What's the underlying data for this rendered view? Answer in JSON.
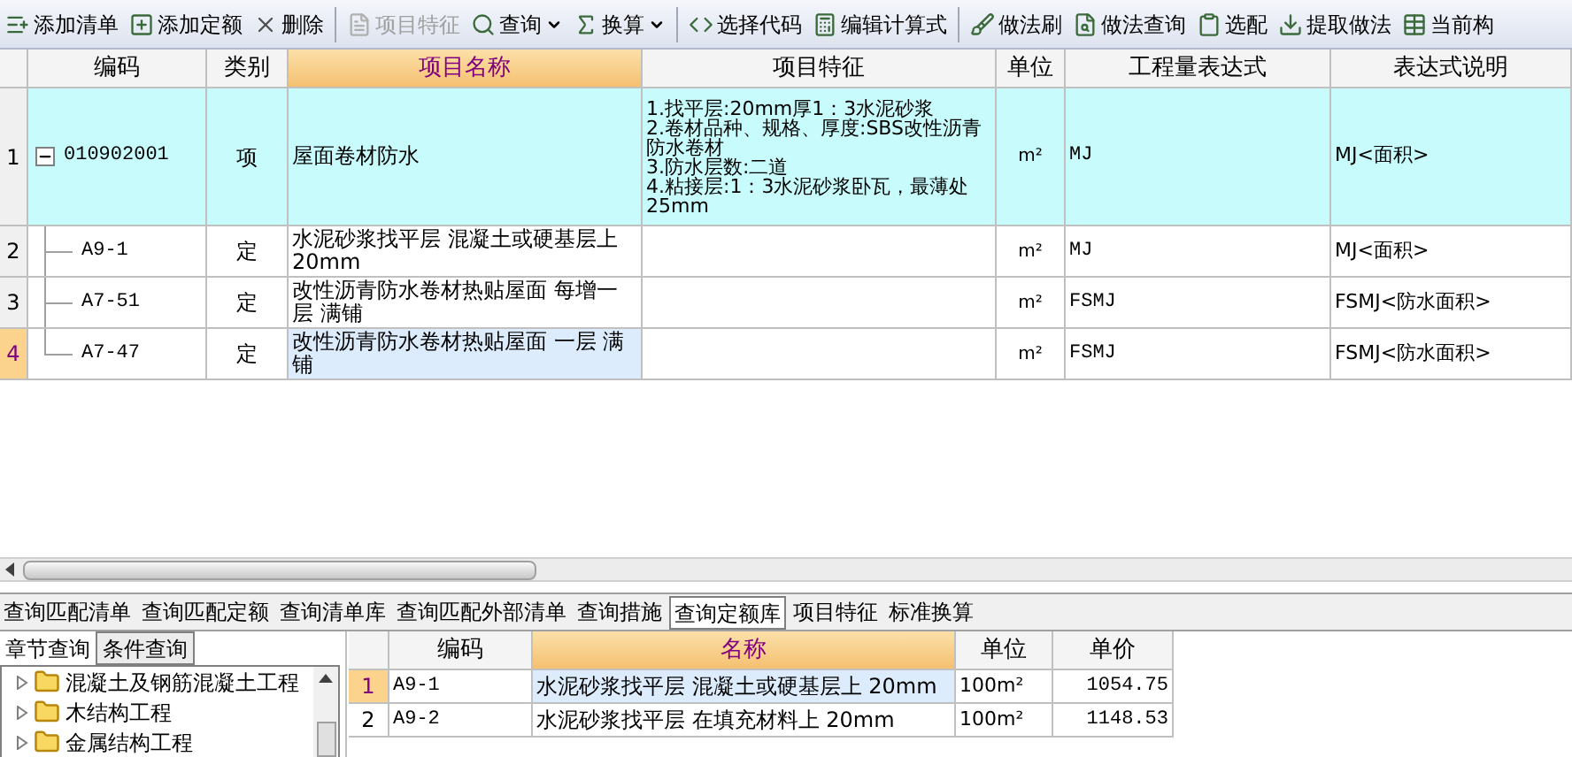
{
  "toolbar": [
    {
      "label": "添加清单",
      "disabled": false,
      "dropdown": false
    },
    {
      "label": "添加定额",
      "disabled": false,
      "dropdown": false
    },
    {
      "label": "删除",
      "disabled": false,
      "dropdown": false
    },
    {
      "label": "项目特征",
      "disabled": true,
      "dropdown": false
    },
    {
      "label": "查询",
      "disabled": false,
      "dropdown": true
    },
    {
      "label": "换算",
      "disabled": false,
      "dropdown": true
    },
    {
      "label": "选择代码",
      "disabled": false,
      "dropdown": false
    },
    {
      "label": "编辑计算式",
      "disabled": false,
      "dropdown": false
    },
    {
      "label": "做法刷",
      "disabled": false,
      "dropdown": false
    },
    {
      "label": "做法查询",
      "disabled": false,
      "dropdown": false
    },
    {
      "label": "选配",
      "disabled": false,
      "dropdown": false
    },
    {
      "label": "提取做法",
      "disabled": false,
      "dropdown": false
    },
    {
      "label": "当前构",
      "disabled": false,
      "dropdown": false
    }
  ],
  "table": {
    "columns": [
      "编码",
      "类别",
      "项目名称",
      "项目特征",
      "单位",
      "工程量表达式",
      "表达式说明"
    ],
    "rows": [
      {
        "number": "1",
        "code": "010902001",
        "category": "项",
        "name": "屋面卷材防水",
        "feature": "1.找平层:20mm厚1：3水泥砂浆\n2.卷材品种、规格、厚度:SBS改性沥青防水卷材\n3.防水层数:二道\n4.粘接层:1：3水泥砂浆卧瓦，最薄处25mm",
        "unit": "m²",
        "expression": "MJ",
        "expression_desc": "MJ<面积>",
        "selected": false,
        "expanded": true,
        "children": [
          {
            "number": "2",
            "code": "A9-1",
            "category": "定",
            "name": "水泥砂浆找平层 混凝土或硬基层上 20mm",
            "unit": "m²",
            "expression": "MJ",
            "expression_desc": "MJ<面积>",
            "selected": false
          },
          {
            "number": "3",
            "code": "A7-51",
            "category": "定",
            "name": "改性沥青防水卷材热贴屋面 每增一层 满铺",
            "unit": "m²",
            "expression": "FSMJ",
            "expression_desc": "FSMJ<防水面积>",
            "selected": false
          },
          {
            "number": "4",
            "code": "A7-47",
            "category": "定",
            "name": "改性沥青防水卷材热贴屋面 一层 满铺",
            "unit": "m²",
            "expression": "FSMJ",
            "expression_desc": "FSMJ<防水面积>",
            "selected": true
          }
        ]
      }
    ]
  },
  "bottom_tabs": [
    {
      "label": "查询匹配清单",
      "selected": false
    },
    {
      "label": "查询匹配定额",
      "selected": false
    },
    {
      "label": "查询清单库",
      "selected": false
    },
    {
      "label": "查询匹配外部清单",
      "selected": false
    },
    {
      "label": "查询措施",
      "selected": false
    },
    {
      "label": "查询定额库",
      "selected": true
    },
    {
      "label": "项目特征",
      "selected": false
    },
    {
      "label": "标准换算",
      "selected": false
    }
  ],
  "search_tabs": [
    {
      "label": "章节查询",
      "selected": true
    },
    {
      "label": "条件查询",
      "selected": false
    }
  ],
  "chapter_tree": [
    {
      "label": "混凝土及钢筋混凝土工程",
      "expanded": false
    },
    {
      "label": "木结构工程",
      "expanded": false
    },
    {
      "label": "金属结构工程",
      "expanded": false
    }
  ],
  "quota_table": {
    "columns": [
      "编码",
      "名称",
      "单位",
      "单价"
    ],
    "rows": [
      {
        "number": "1",
        "code": "A9-1",
        "name": "水泥砂浆找平层 混凝土或硬基层上 20mm",
        "unit": "100m²",
        "price": "1054.75",
        "selected": true
      },
      {
        "number": "2",
        "code": "A9-2",
        "name": "水泥砂浆找平层 在填充材料上 20mm",
        "unit": "100m²",
        "price": "1148.53",
        "selected": false
      }
    ]
  }
}
